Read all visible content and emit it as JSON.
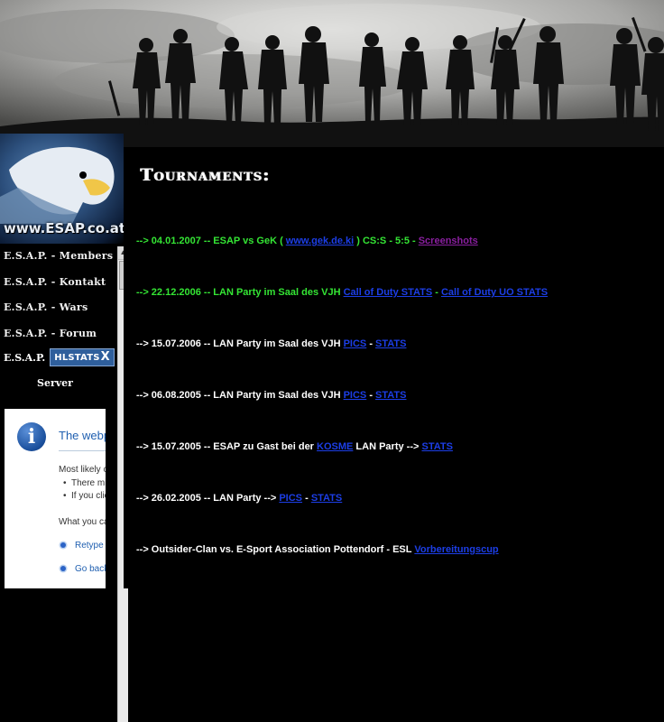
{
  "sidebar": {
    "logo_text": "www.ESAP.co.at",
    "menu": [
      {
        "label": "E.S.A.P. - Members"
      },
      {
        "label": "E.S.A.P. - Kontakt"
      },
      {
        "label": "E.S.A.P. - Wars"
      },
      {
        "label": "E.S.A.P. - Forum"
      }
    ],
    "hlstats": {
      "prefix": "E.S.A.P.",
      "badge": "HLSTATS",
      "badge_x": "X"
    },
    "server_label": "Server"
  },
  "error_frame": {
    "title": "The webpage cannot be found",
    "most_likely": "Most likely causes:",
    "bullets": [
      "There might be a typing error in the address.",
      "If you clicked on a link, it may be out of date."
    ],
    "what_you_can": "What you can try:",
    "options": [
      "Retype the address.",
      "Go back to the previous page."
    ]
  },
  "main": {
    "title": "Tournaments:",
    "entries": [
      {
        "color": "green",
        "parts": [
          {
            "t": "--> 04.01.2007 -- ESAP vs GeK ( "
          },
          {
            "t": "www.gek.de.ki",
            "link": true
          },
          {
            "t": " ) CS:S - 5:5 - "
          },
          {
            "t": "Screenshots",
            "link": true,
            "visited": true
          }
        ]
      },
      {
        "color": "green",
        "parts": [
          {
            "t": "--> 22.12.2006 -- LAN Party im Saal des VJH "
          },
          {
            "t": "Call of Duty STATS",
            "link": true
          },
          {
            "t": " - "
          },
          {
            "t": "Call of Duty UO STATS",
            "link": true
          }
        ]
      },
      {
        "color": "white",
        "parts": [
          {
            "t": "--> 15.07.2006 -- LAN Party im Saal des VJH "
          },
          {
            "t": "PICS",
            "link": true
          },
          {
            "t": " - "
          },
          {
            "t": "STATS",
            "link": true
          }
        ]
      },
      {
        "color": "white",
        "parts": [
          {
            "t": "--> 06.08.2005 -- LAN Party im Saal des VJH "
          },
          {
            "t": "PICS",
            "link": true
          },
          {
            "t": " - "
          },
          {
            "t": "STATS",
            "link": true
          }
        ]
      },
      {
        "color": "white",
        "parts": [
          {
            "t": "--> 15.07.2005 -- ESAP zu Gast bei der "
          },
          {
            "t": "KOSME",
            "link": true
          },
          {
            "t": " LAN Party --> "
          },
          {
            "t": "STATS",
            "link": true
          }
        ]
      },
      {
        "color": "white",
        "parts": [
          {
            "t": "--> 26.02.2005 -- LAN Party --> "
          },
          {
            "t": "PICS",
            "link": true
          },
          {
            "t": " - "
          },
          {
            "t": "STATS",
            "link": true
          }
        ]
      },
      {
        "color": "white",
        "parts": [
          {
            "t": "--> Outsider-Clan vs. E-Sport Association Pottendorf - ESL "
          },
          {
            "t": "Vorbereitungscup",
            "link": true
          }
        ]
      }
    ]
  }
}
